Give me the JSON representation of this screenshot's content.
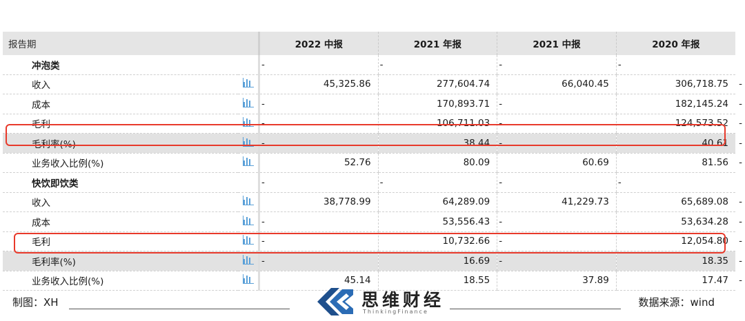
{
  "table": {
    "header": {
      "label": "报告期",
      "columns": [
        "2022 中报",
        "2021 年报",
        "2021 中报",
        "2020 年报"
      ]
    },
    "rows": [
      {
        "label": "冲泡类",
        "category": true,
        "cells": [
          {
            "v": "",
            "d": "-"
          },
          {
            "v": "",
            "d": "-"
          },
          {
            "v": "",
            "d": "-"
          },
          {
            "v": "",
            "d": "-"
          }
        ],
        "tail": "-"
      },
      {
        "label": "收入",
        "cells": [
          {
            "v": "45,325.86"
          },
          {
            "v": "277,604.74"
          },
          {
            "v": "66,040.45"
          },
          {
            "v": "306,718.75"
          }
        ],
        "tail": "-"
      },
      {
        "label": "成本",
        "cells": [
          {
            "v": "",
            "d": "-"
          },
          {
            "v": "170,893.71"
          },
          {
            "v": "",
            "d": "-"
          },
          {
            "v": "182,145.24"
          }
        ],
        "tail": "-"
      },
      {
        "label": "毛利",
        "cells": [
          {
            "v": "",
            "d": "-"
          },
          {
            "v": "106,711.03"
          },
          {
            "v": "",
            "d": "-"
          },
          {
            "v": "124,573.52"
          }
        ],
        "tail": "-"
      },
      {
        "label": "毛利率(%)",
        "gray": true,
        "cells": [
          {
            "v": "",
            "d": "-"
          },
          {
            "v": "38.44"
          },
          {
            "v": "",
            "d": "-"
          },
          {
            "v": "40.61"
          }
        ],
        "tail": "-"
      },
      {
        "label": "业务收入比例(%)",
        "cells": [
          {
            "v": "52.76"
          },
          {
            "v": "80.09"
          },
          {
            "v": "60.69"
          },
          {
            "v": "81.56"
          }
        ],
        "tail": "-"
      },
      {
        "label": "快饮即饮类",
        "category": true,
        "cells": [
          {
            "v": "",
            "d": "-"
          },
          {
            "v": "",
            "d": "-"
          },
          {
            "v": "",
            "d": "-"
          },
          {
            "v": "",
            "d": "-"
          }
        ],
        "tail": "-"
      },
      {
        "label": "收入",
        "cells": [
          {
            "v": "38,778.99"
          },
          {
            "v": "64,289.09"
          },
          {
            "v": "41,229.73"
          },
          {
            "v": "65,689.08"
          }
        ],
        "tail": "-"
      },
      {
        "label": "成本",
        "cells": [
          {
            "v": "",
            "d": "-"
          },
          {
            "v": "53,556.43"
          },
          {
            "v": "",
            "d": "-"
          },
          {
            "v": "53,634.28"
          }
        ],
        "tail": "-"
      },
      {
        "label": "毛利",
        "cells": [
          {
            "v": "",
            "d": "-"
          },
          {
            "v": "10,732.66"
          },
          {
            "v": "",
            "d": "-"
          },
          {
            "v": "12,054.80"
          }
        ],
        "tail": "-"
      },
      {
        "label": "毛利率(%)",
        "gray": true,
        "cells": [
          {
            "v": "",
            "d": "-"
          },
          {
            "v": "16.69"
          },
          {
            "v": "",
            "d": "-"
          },
          {
            "v": "18.35"
          }
        ],
        "tail": "-"
      },
      {
        "label": "业务收入比例(%)",
        "cells": [
          {
            "v": "45.14"
          },
          {
            "v": "18.55"
          },
          {
            "v": "37.89"
          },
          {
            "v": "17.47"
          }
        ],
        "tail": "-"
      }
    ],
    "row_icon": "bar-chart-icon"
  },
  "colors": {
    "highlight": "#e8392a",
    "icon": "#5aa0d8"
  },
  "footer": {
    "left": "制图：XH",
    "right": "数据来源：wind",
    "logo_cn": "思维财经",
    "logo_en": "ThinkingFinance"
  }
}
